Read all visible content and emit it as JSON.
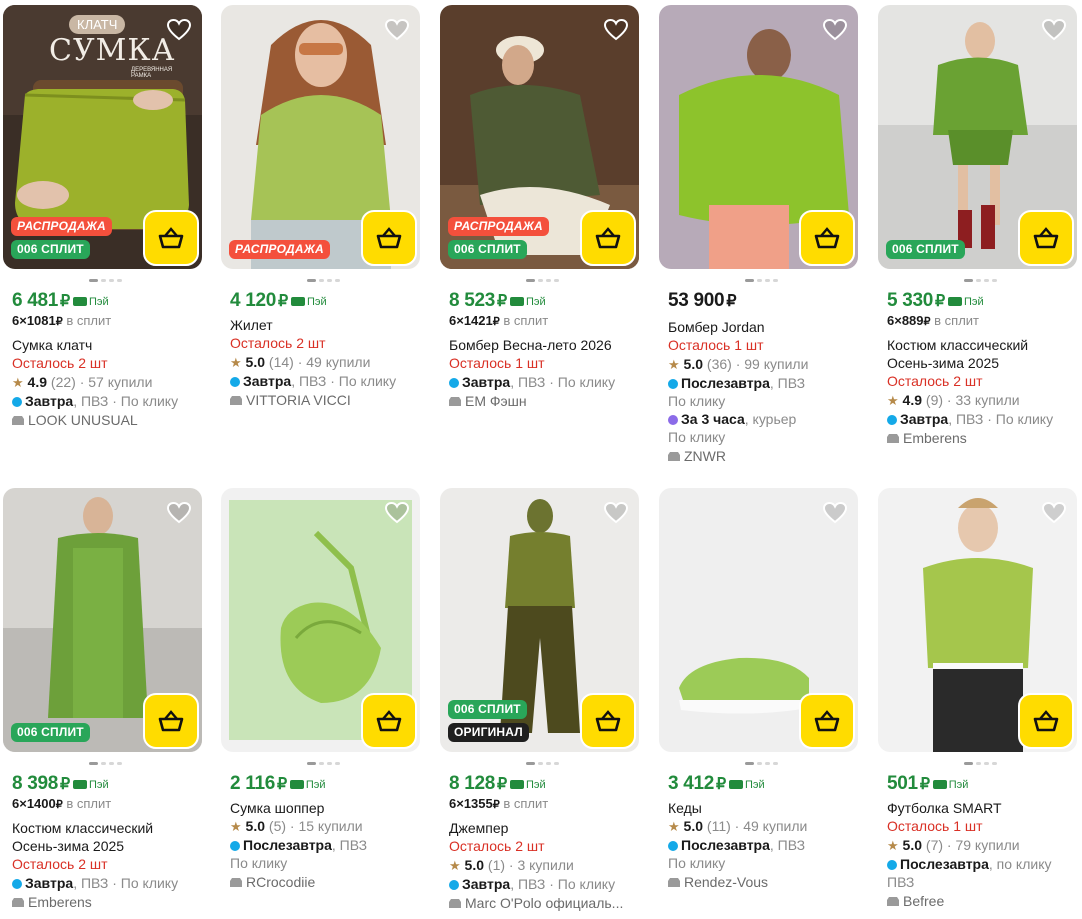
{
  "currency": "₽",
  "pay_label": "Пэй",
  "split_suffix": "в сплит",
  "badges": {
    "sale": "РАСПРОДАЖА",
    "split": "006 СПЛИТ",
    "original": "ОРИГИНАЛ"
  },
  "photo_overlay": {
    "klatch": "КЛАТЧ",
    "sumka": "СУМКА",
    "sub": "ДЕРЕВЯННАЯ РАМКА"
  },
  "products": [
    {
      "price": "6 481",
      "split_sum": "6×1081",
      "title": "Сумка клатч",
      "left": "Осталось 2 шт",
      "rating": "4.9",
      "reviews": "(22)",
      "bought": "· 57 купили",
      "delivery_bold": "Завтра",
      "delivery_rest": ", ПВЗ · По клику",
      "seller": "LOOK UNUSUAL"
    },
    {
      "price": "4 120",
      "title": "Жилет",
      "left": "Осталось 2 шт",
      "rating": "5.0",
      "reviews": "(14)",
      "bought": "· 49 купили",
      "delivery_bold": "Завтра",
      "delivery_rest": ", ПВЗ · По клику",
      "seller": "VITTORIA VICCI"
    },
    {
      "price": "8 523",
      "split_sum": "6×1421",
      "title": "Бомбер Весна-лето 2026",
      "left": "Осталось 1 шт",
      "delivery_bold": "Завтра",
      "delivery_rest": ", ПВЗ · По клику",
      "seller": "EM Фэшн"
    },
    {
      "price": "53 900",
      "title": "Бомбер Jordan",
      "left": "Осталось 1 шт",
      "rating": "5.0",
      "reviews": "(36)",
      "bought": "· 99 купили",
      "delivery_bold": "Послезавтра",
      "delivery_rest": ", ПВЗ",
      "delivery_line2": "По клику",
      "delivery2_bold": "За 3 часа",
      "delivery2_rest": ", курьер",
      "delivery2_line2": "По клику",
      "seller": "ZNWR"
    },
    {
      "price": "5 330",
      "split_sum": "6×889",
      "title": "Костюм классический Осень-зима 2025",
      "left": "Осталось 2 шт",
      "rating": "4.9",
      "reviews": "(9)",
      "bought": "· 33 купили",
      "delivery_bold": "Завтра",
      "delivery_rest": ", ПВЗ · По клику",
      "seller": "Emberens"
    },
    {
      "price": "8 398",
      "split_sum": "6×1400",
      "title": "Костюм классический Осень-зима 2025",
      "left": "Осталось 2 шт",
      "delivery_bold": "Завтра",
      "delivery_rest": ", ПВЗ · По клику",
      "seller": "Emberens"
    },
    {
      "price": "2 116",
      "title": "Сумка шоппер",
      "rating": "5.0",
      "reviews": "(5)",
      "bought": "· 15 купили",
      "delivery_bold": "Послезавтра",
      "delivery_rest": ", ПВЗ",
      "delivery_line2": "По клику",
      "seller": "RCrocodiie"
    },
    {
      "price": "8 128",
      "split_sum": "6×1355",
      "title": "Джемпер",
      "left": "Осталось 2 шт",
      "rating": "5.0",
      "reviews": "(1)",
      "bought": "· 3 купили",
      "delivery_bold": "Завтра",
      "delivery_rest": ", ПВЗ · По клику",
      "seller": "Marc O'Polo официаль..."
    },
    {
      "price": "3 412",
      "title": "Кеды",
      "rating": "5.0",
      "reviews": "(11)",
      "bought": "· 49 купили",
      "delivery_bold": "Послезавтра",
      "delivery_rest": ", ПВЗ",
      "delivery_line2": "По клику",
      "seller": "Rendez-Vous"
    },
    {
      "price": "501",
      "title": "Футболка SMART",
      "left": "Осталось 1 шт",
      "rating": "5.0",
      "reviews": "(7)",
      "bought": "· 79 купили",
      "delivery_bold": "Послезавтра",
      "delivery_rest": ", по клику",
      "delivery_line2": "ПВЗ",
      "seller": "Befree"
    }
  ],
  "colors": {
    "price_green": "#228b3c",
    "left_red": "#d93025",
    "cart_yellow": "#ffdc00",
    "sale_red": "#f4503c",
    "split_green": "#29a659"
  }
}
